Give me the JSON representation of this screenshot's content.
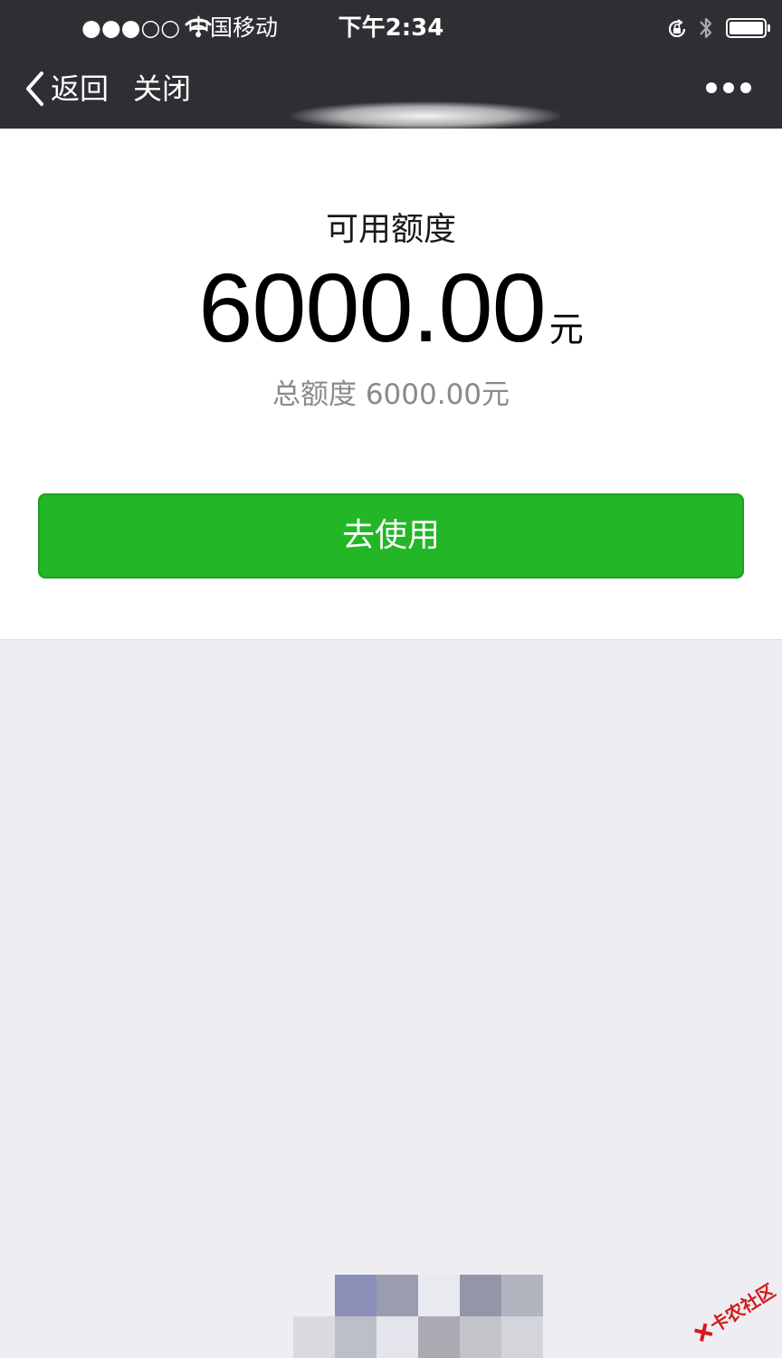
{
  "status_bar": {
    "carrier": "●●●○○ 中国移动",
    "time": "下午2:34",
    "signal_bars_filled": 3,
    "signal_bars_total": 5,
    "wifi_icon": "wifi-icon",
    "lock_icon": "rotation-lock-icon",
    "bluetooth_icon": "bluetooth-icon",
    "battery_icon": "battery-icon"
  },
  "nav": {
    "back_label": "返回",
    "close_label": "关闭",
    "more_icon": "more-dots-icon",
    "title_obscured": true
  },
  "credit": {
    "available_label": "可用额度",
    "available_amount": "6000.00",
    "available_unit": "元",
    "total_line": "总额度 6000.00元"
  },
  "actions": {
    "use_button_label": "去使用"
  },
  "watermark": {
    "text": "卡农社区"
  },
  "colors": {
    "topbar": "#2e2f33",
    "button_green": "#23b626",
    "page_bg": "#ededf2",
    "muted_text": "#8a8a8a"
  }
}
